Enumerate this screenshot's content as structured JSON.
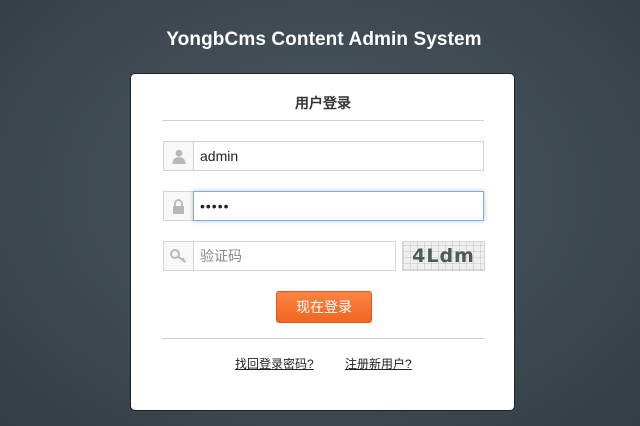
{
  "app": {
    "title": "YongbCms Content Admin System"
  },
  "login": {
    "heading": "用户登录",
    "username": {
      "value": "admin",
      "icon": "user-icon"
    },
    "password": {
      "value": "•••••",
      "icon": "lock-icon"
    },
    "captcha": {
      "value": "",
      "placeholder": "验证码",
      "icon": "key-icon",
      "image_text": "4Ldm"
    },
    "submit_label": "现在登录",
    "forgot_password_label": "找回登录密码?",
    "register_label": "注册新用户?"
  },
  "colors": {
    "background": "#3d4850",
    "panel": "#ffffff",
    "button": "#f26522",
    "focus_border": "#7fb1e0"
  }
}
